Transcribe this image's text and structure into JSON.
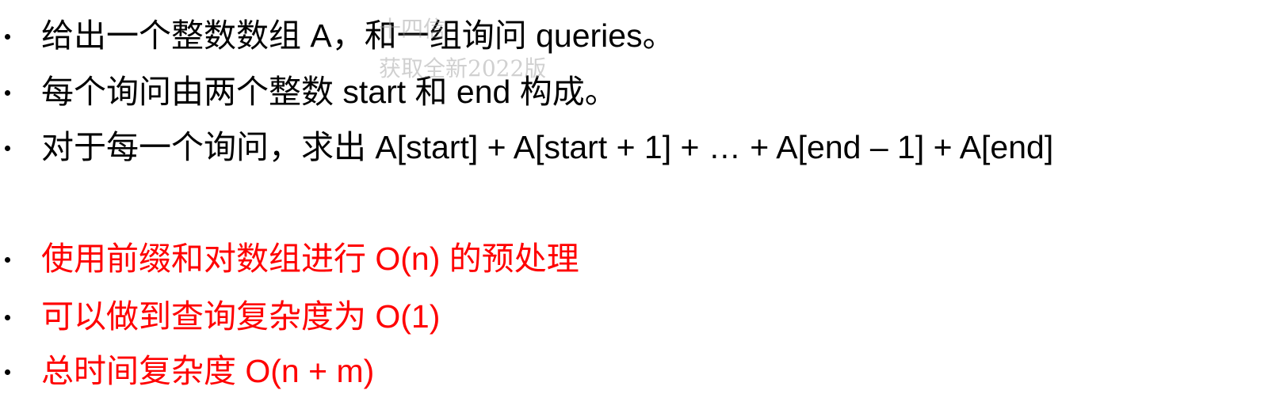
{
  "bullets": [
    {
      "text": "给出一个整数数组 A，和一组询问 queries。",
      "color": "#000000"
    },
    {
      "text": "每个询问由两个整数 start 和 end 构成。",
      "color": "#000000"
    },
    {
      "text": "对于每一个询问，求出 A[start] + A[start + 1] + … + A[end – 1] + A[end]",
      "color": "#000000"
    },
    {
      "text": "使用前缀和对数组进行 O(n) 的预处理",
      "color": "#ff0000"
    },
    {
      "text": "可以做到查询复杂度为 O(1)",
      "color": "#ff0000"
    },
    {
      "text": "总时间复杂度 O(n + m)",
      "color": "#ff0000"
    }
  ],
  "watermark": {
    "line1": "十四信",
    "line2": "获取全新2022版"
  }
}
